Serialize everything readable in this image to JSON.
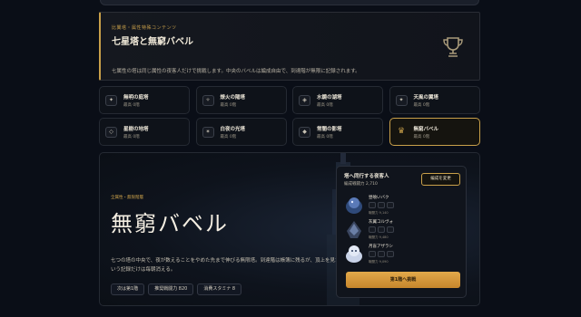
{
  "header": {
    "kicker": "比翼塔・属性特殊コンテンツ",
    "title": "七星塔と無窮バベル",
    "description": "七属性の塔は同じ属性の夜客人だけで挑戦します。中央のバベルは編成自由で、到達階が無限に記録されます。",
    "icon": "trophy-icon"
  },
  "towers": [
    {
      "name": "無明の庭塔",
      "floor": "最高 0階",
      "icon": "✦"
    },
    {
      "name": "燎火の陽塔",
      "floor": "最高 0階",
      "icon": "✧"
    },
    {
      "name": "水鏡の湖塔",
      "floor": "最高 0階",
      "icon": "◈"
    },
    {
      "name": "天風の翼塔",
      "floor": "最高 0階",
      "icon": "✦"
    },
    {
      "name": "星樹の地塔",
      "floor": "最高 0階",
      "icon": "◇"
    },
    {
      "name": "白夜の光塔",
      "floor": "最高 0階",
      "icon": "✶"
    },
    {
      "name": "常闇の影塔",
      "floor": "最高 0階",
      "icon": "◆"
    },
    {
      "name": "無窮バベル",
      "floor": "最高 0階",
      "icon": "♛",
      "active": true
    }
  ],
  "main": {
    "kicker": "全属性・無限階層",
    "title": "無窮バベル",
    "description": "七つの塔の中央で、夜が数えることをやめた先まで伸びる無限塔。到達階は帳簿に残るが、頂上を見たという記録だけは毎朝消える。",
    "chips": [
      "次は第1階",
      "推奨戦闘力 820",
      "消費スタミナ 8"
    ]
  },
  "party": {
    "title": "塔へ同行する夜客人",
    "power": "編成戦闘力 2,710",
    "edit_label": "編成を変更",
    "members": [
      {
        "name": "昼喰いバク",
        "power": "戦闘力 9,140"
      },
      {
        "name": "灰翼コルヴォ",
        "power": "戦闘力 9,480"
      },
      {
        "name": "月盲アザラシ",
        "power": "戦闘力 9,090"
      }
    ],
    "challenge_label": "第1階へ挑戦"
  },
  "colors": {
    "accent": "#c9a04a",
    "background": "#0a0e17",
    "button": "#d99a3e"
  }
}
